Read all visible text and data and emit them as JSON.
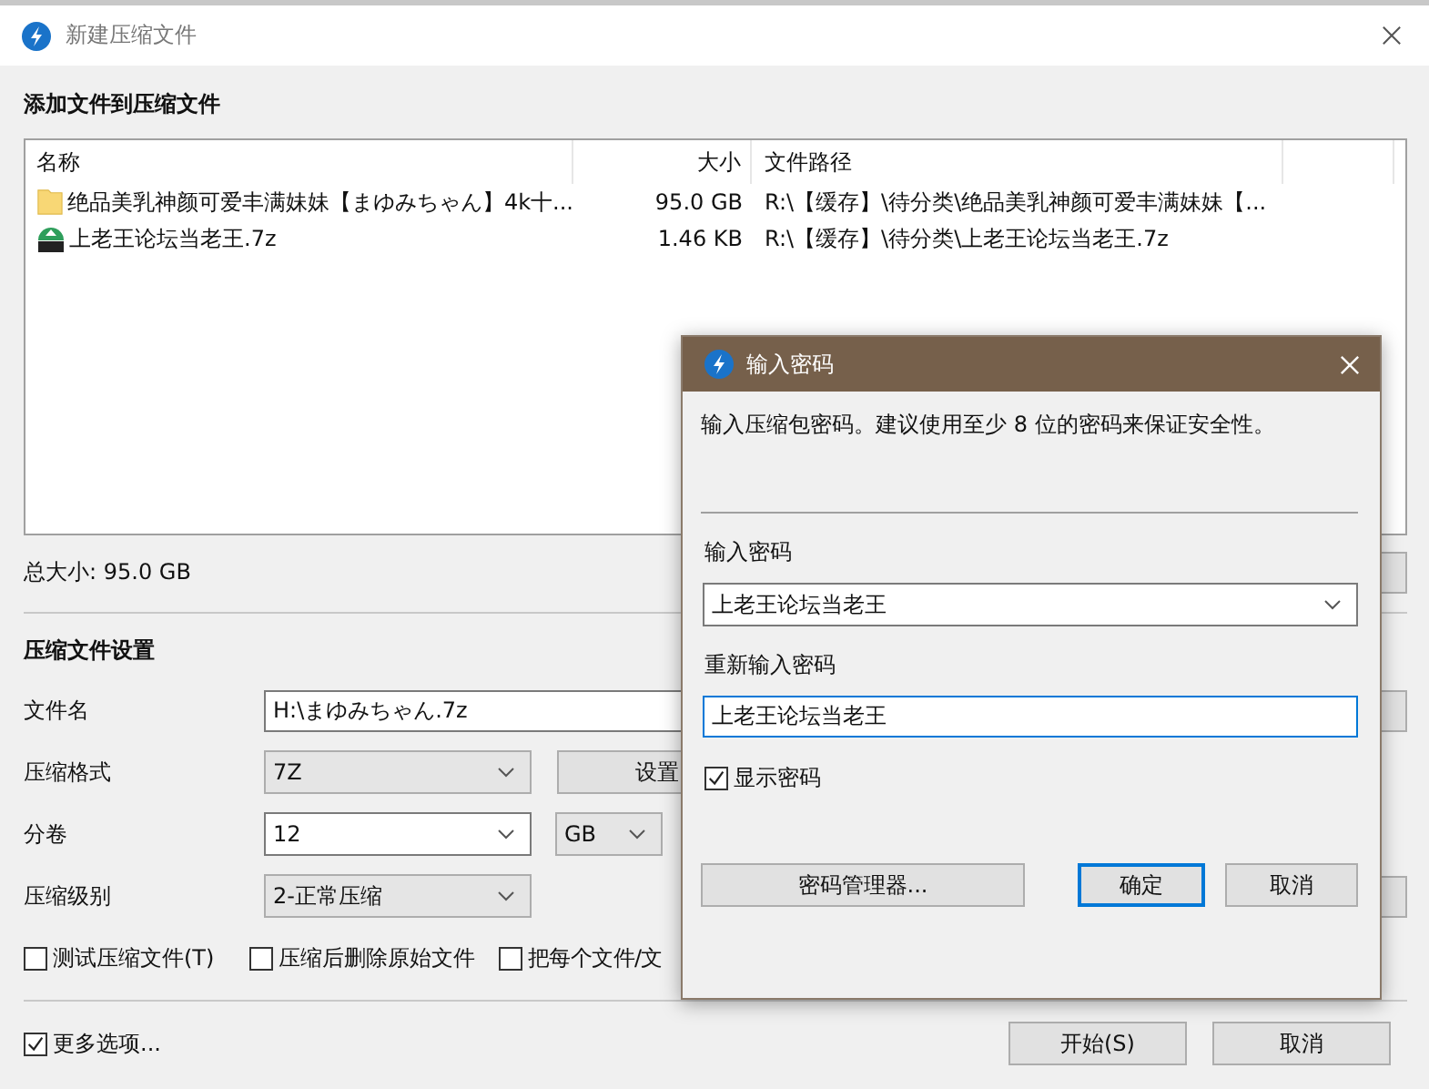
{
  "window": {
    "title": "新建压缩文件"
  },
  "files_section": {
    "heading": "添加文件到压缩文件",
    "columns": [
      "名称",
      "大小",
      "文件路径"
    ],
    "rows": [
      {
        "kind": "folder",
        "name": "绝品美乳神颜可爱丰满妹妹【まゆみちゃん】4k十...",
        "size": "95.0 GB",
        "path": "R:\\【缓存】\\待分类\\绝品美乳神颜可爱丰满妹妹【..."
      },
      {
        "kind": "archive",
        "name": "上老王论坛当老王.7z",
        "size": "1.46 KB",
        "path": "R:\\【缓存】\\待分类\\上老王论坛当老王.7z"
      }
    ],
    "total": "总大小: 95.0 GB"
  },
  "settings": {
    "heading": "压缩文件设置",
    "filename": {
      "label": "文件名",
      "value": "H:\\まゆみちゃん.7z"
    },
    "format": {
      "label": "压缩格式",
      "value": "7Z",
      "button": "设置"
    },
    "split": {
      "label": "分卷",
      "value": "12",
      "unit": "GB"
    },
    "level": {
      "label": "压缩级别",
      "value": "2-正常压缩"
    },
    "options": [
      {
        "label": "测试压缩文件(T)",
        "checked": false
      },
      {
        "label": "压缩后删除原始文件",
        "checked": false
      },
      {
        "label": "把每个文件/文",
        "checked": false
      }
    ]
  },
  "more_options": {
    "label": "更多选项...",
    "checked": true
  },
  "buttons": [
    "开始(S)",
    "取消"
  ],
  "password_dialog": {
    "title": "输入密码",
    "message": "输入压缩包密码。建议使用至少 8 位的密码来保证安全性。",
    "password_label": "输入密码",
    "password": "上老王论坛当老王",
    "confirm_label": "重新输入密码",
    "confirm": "上老王论坛当老王",
    "show_password": {
      "label": "显示密码",
      "checked": true
    },
    "buttons": [
      {
        "label": "密码管理器...",
        "default": false
      },
      {
        "label": "确定",
        "default": true
      },
      {
        "label": "取消",
        "default": false
      }
    ]
  }
}
